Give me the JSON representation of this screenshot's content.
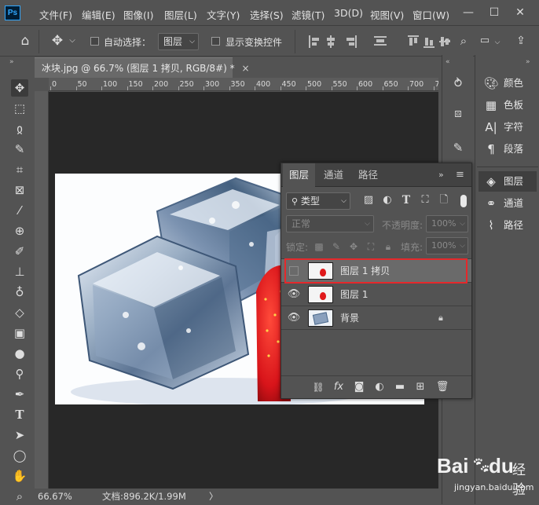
{
  "app": {
    "logo": "Ps"
  },
  "menu": [
    "文件(F)",
    "编辑(E)",
    "图像(I)",
    "图层(L)",
    "文字(Y)",
    "选择(S)",
    "滤镜(T)",
    "3D(D)",
    "视图(V)",
    "窗口(W)"
  ],
  "window_controls": {
    "minimize": "—",
    "maximize": "☐",
    "close": "✕"
  },
  "options": {
    "auto_select_label": "自动选择：",
    "auto_select_value": "图层",
    "show_transform_label": "显示变换控件"
  },
  "document": {
    "tab_title": "冰块.jpg @ 66.7% (图层 1 拷贝, RGB/8#) *",
    "tab_close": "×"
  },
  "ruler": {
    "labels": [
      "0",
      "50",
      "100",
      "150",
      "200",
      "250",
      "300",
      "350",
      "400",
      "450",
      "500",
      "550",
      "600",
      "650",
      "700",
      "750"
    ]
  },
  "status": {
    "zoom": "66.67%",
    "doc_info": "文档:896.2K/1.99M",
    "arrow": "〉"
  },
  "right_panels": {
    "top": [
      {
        "icon": "palette-icon",
        "label": "颜色"
      },
      {
        "icon": "swatches-icon",
        "label": "色板"
      },
      {
        "icon": "character-icon",
        "label": "字符"
      },
      {
        "icon": "paragraph-icon",
        "label": "段落"
      }
    ],
    "bottom": [
      {
        "icon": "layers-icon",
        "label": "图层"
      },
      {
        "icon": "channels-icon",
        "label": "通道"
      },
      {
        "icon": "paths-icon",
        "label": "路径"
      }
    ]
  },
  "layers_panel": {
    "tabs": [
      "图层",
      "通道",
      "路径"
    ],
    "active_tab": "图层",
    "filter_label": "类型",
    "blend_mode": "正常",
    "opacity_label": "不透明度:",
    "opacity_value": "100%",
    "lock_label": "锁定:",
    "fill_label": "填充:",
    "fill_value": "100%",
    "layers": [
      {
        "name": "图层 1 拷贝",
        "visible": false,
        "selected": true
      },
      {
        "name": "图层 1",
        "visible": true,
        "selected": false
      },
      {
        "name": "背景",
        "visible": true,
        "selected": false,
        "locked": true
      }
    ]
  },
  "colors": {
    "highlight": "#e5282b",
    "strawberry": "#e0191b",
    "accent_blue": "#31a8ff"
  },
  "watermark": {
    "brand": "Bai",
    "brand2": "du",
    "suffix": "经验",
    "url": "jingyan.baidu.com"
  }
}
